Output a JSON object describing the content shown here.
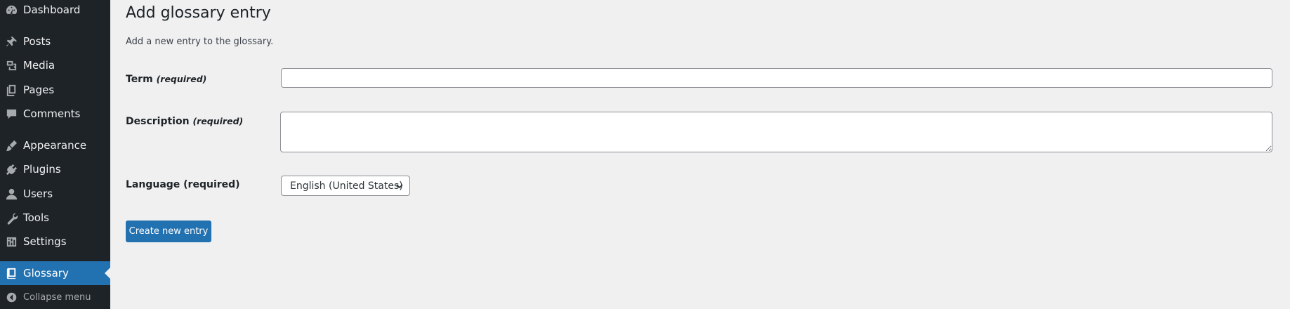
{
  "sidebar": {
    "items": [
      {
        "label": "Dashboard",
        "icon": "dashboard-icon"
      },
      {
        "label": "Posts",
        "icon": "pushpin-icon"
      },
      {
        "label": "Media",
        "icon": "media-icon"
      },
      {
        "label": "Pages",
        "icon": "pages-icon"
      },
      {
        "label": "Comments",
        "icon": "comment-icon"
      },
      {
        "label": "Appearance",
        "icon": "paintbrush-icon"
      },
      {
        "label": "Plugins",
        "icon": "plugin-icon"
      },
      {
        "label": "Users",
        "icon": "user-icon"
      },
      {
        "label": "Tools",
        "icon": "wrench-icon"
      },
      {
        "label": "Settings",
        "icon": "settings-icon"
      },
      {
        "label": "Glossary",
        "icon": "book-icon",
        "active": true
      }
    ],
    "collapse_label": "Collapse menu"
  },
  "page": {
    "title": "Add glossary entry",
    "description": "Add a new entry to the glossary."
  },
  "form": {
    "term_label": "Term",
    "term_required": "(required)",
    "term_value": "",
    "description_label": "Description",
    "description_required": "(required)",
    "description_value": "",
    "language_label": "Language (required)",
    "language_selected": "English (United States)",
    "submit_label": "Create new entry"
  },
  "colors": {
    "sidebar_bg": "#1d2327",
    "accent": "#2271b1",
    "page_bg": "#f0f0f1"
  }
}
